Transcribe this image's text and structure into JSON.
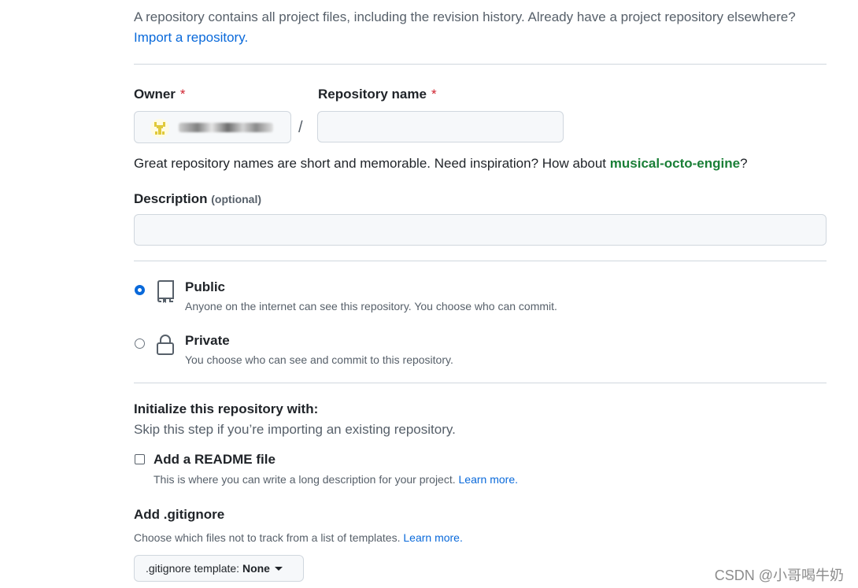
{
  "intro": {
    "text": "A repository contains all project files, including the revision history. Already have a project repository elsewhere?",
    "import_link": "Import a repository."
  },
  "owner": {
    "label": "Owner",
    "required_mark": "*",
    "separator": "/"
  },
  "repo_name": {
    "label": "Repository name",
    "required_mark": "*",
    "value": "",
    "hint_prefix": "Great repository names are short and memorable. Need inspiration? How about",
    "suggestion": "musical-octo-engine",
    "hint_suffix": "?"
  },
  "description": {
    "label": "Description",
    "optional": "(optional)",
    "value": ""
  },
  "visibility": {
    "selected": "public",
    "public": {
      "title": "Public",
      "desc": "Anyone on the internet can see this repository. You choose who can commit."
    },
    "private": {
      "title": "Private",
      "desc": "You choose who can see and commit to this repository."
    }
  },
  "initialize": {
    "title": "Initialize this repository with:",
    "subtitle": "Skip this step if you’re importing an existing repository.",
    "readme": {
      "label": "Add a README file",
      "checked": false,
      "desc": "This is where you can write a long description for your project.",
      "learn_more": "Learn more."
    }
  },
  "gitignore": {
    "title": "Add .gitignore",
    "desc": "Choose which files not to track from a list of templates.",
    "learn_more": "Learn more.",
    "button_prefix": ".gitignore template:",
    "button_value": "None"
  },
  "watermark": "CSDN @小哥喝牛奶",
  "colors": {
    "accent": "#0969da",
    "required": "#cf222e",
    "suggestion": "#1a7f37"
  }
}
